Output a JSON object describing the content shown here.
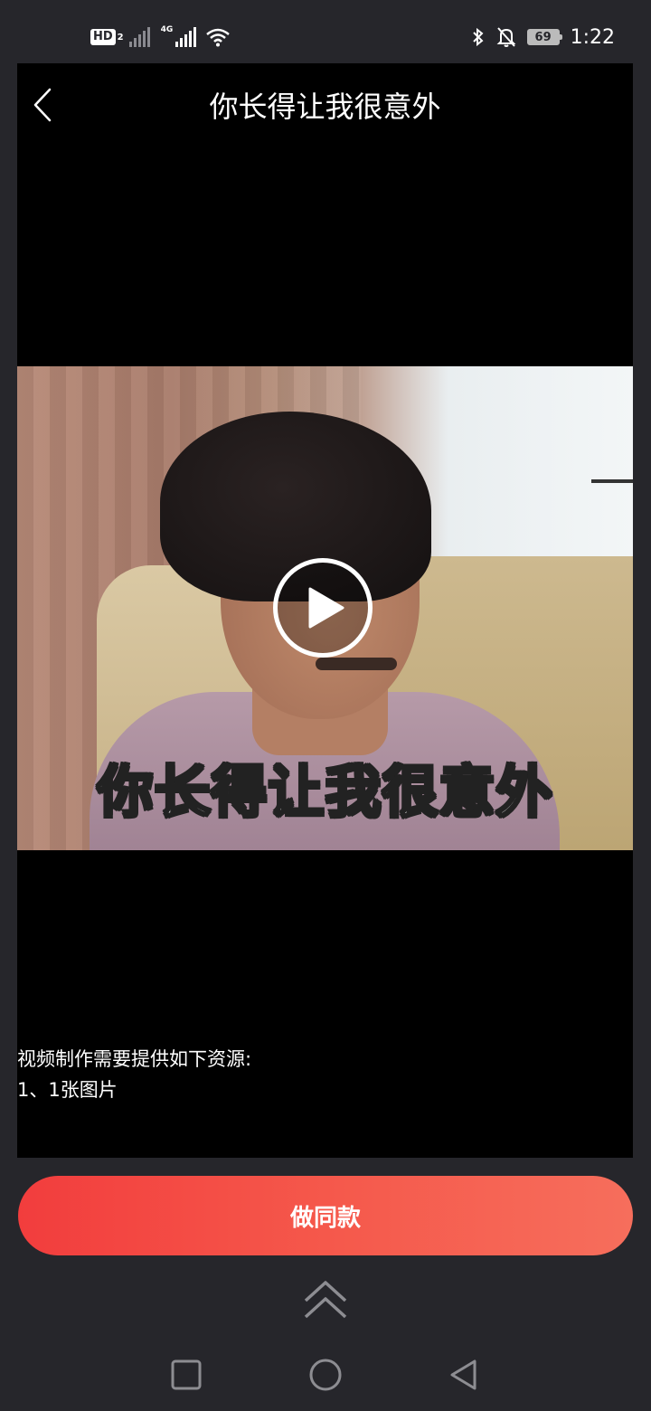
{
  "status_bar": {
    "hd_label": "HD",
    "hd_sub": "2",
    "network_label": "4G",
    "battery_level": "69",
    "time": "1:22",
    "icons": [
      "bluetooth-icon",
      "mute-bell-icon",
      "wifi-icon",
      "signal-icon"
    ]
  },
  "header": {
    "title": "你长得让我很意外"
  },
  "video": {
    "caption": "你长得让我很意外"
  },
  "info": {
    "line1": "视频制作需要提供如下资源:",
    "line2": "1、1张图片"
  },
  "action": {
    "label": "做同款"
  },
  "colors": {
    "accent_start": "#f23d3d",
    "accent_end": "#f66e5c",
    "background": "#26262b",
    "panel": "#000000"
  }
}
